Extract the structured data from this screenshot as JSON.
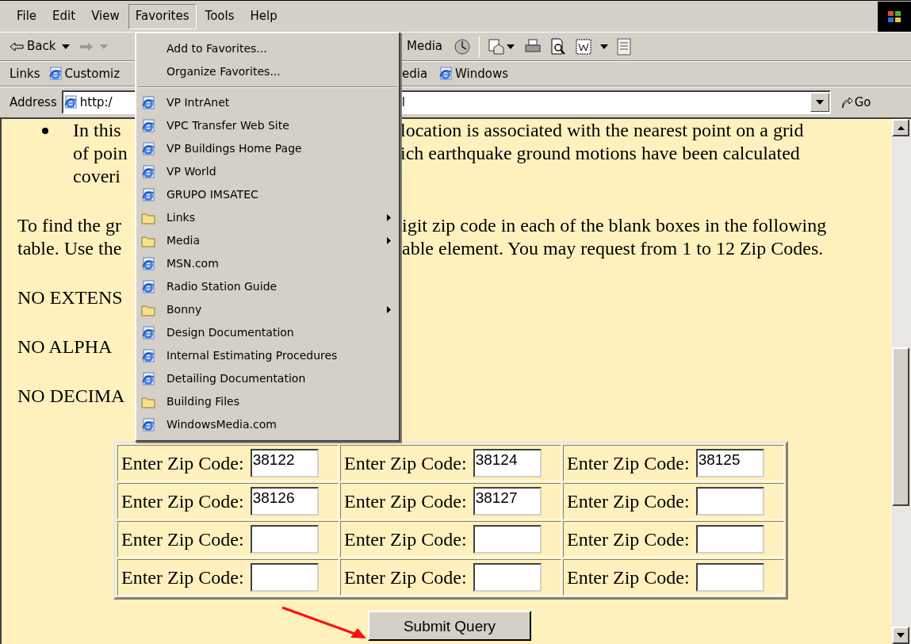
{
  "menubar": [
    {
      "label": "File",
      "selected": false
    },
    {
      "label": "Edit",
      "selected": false
    },
    {
      "label": "View",
      "selected": false
    },
    {
      "label": "Favorites",
      "selected": true
    },
    {
      "label": "Tools",
      "selected": false
    },
    {
      "label": "Help",
      "selected": false
    }
  ],
  "toolbar": {
    "back": "Back",
    "media": "Media"
  },
  "links_bar": {
    "label": "Links",
    "left_links": [
      "Customiz"
    ],
    "right_links": [
      {
        "label": "edia",
        "icon": false
      },
      {
        "label": "Windows",
        "icon": true
      }
    ]
  },
  "address_bar": {
    "label": "Address",
    "value_start": "http:/",
    "value_end": "l",
    "go": "Go"
  },
  "favorites_menu": [
    {
      "kind": "command",
      "label": "Add to Favorites..."
    },
    {
      "kind": "command",
      "label": "Organize Favorites..."
    },
    {
      "kind": "link",
      "label": "VP IntrAnet"
    },
    {
      "kind": "link",
      "label": "VPC Transfer Web Site"
    },
    {
      "kind": "link",
      "label": "VP Buildings Home Page"
    },
    {
      "kind": "link",
      "label": "VP World"
    },
    {
      "kind": "link",
      "label": "GRUPO IMSATEC"
    },
    {
      "kind": "folder",
      "label": "Links",
      "submenu": true
    },
    {
      "kind": "folder",
      "label": "Media",
      "submenu": true
    },
    {
      "kind": "link",
      "label": "MSN.com"
    },
    {
      "kind": "link",
      "label": "Radio Station Guide"
    },
    {
      "kind": "folder",
      "label": "Bonny",
      "submenu": true
    },
    {
      "kind": "link",
      "label": "Design Documentation"
    },
    {
      "kind": "link",
      "label": "Internal Estimating Procedures"
    },
    {
      "kind": "link",
      "label": "Detailing Documentation"
    },
    {
      "kind": "folder",
      "label": "Building Files",
      "submenu": false
    },
    {
      "kind": "link",
      "label": "WindowsMedia.com"
    }
  ],
  "page": {
    "paragraphs": [
      {
        "kind": "bullet",
        "lines": [
          {
            "left": "In this",
            "right": "location is associated with the nearest point on a grid"
          },
          {
            "left": "of poin",
            "right": "ich earthquake ground motions have been calculated"
          },
          {
            "left": "coveri"
          }
        ]
      },
      {
        "kind": "text",
        "lines": [
          {
            "left": "To find the gr",
            "right": "igit zip code in each of the blank boxes in the following"
          },
          {
            "left": "table. Use the",
            "right": "able element. You may request from 1 to 12 Zip Codes."
          }
        ]
      },
      {
        "kind": "text",
        "lines": [
          {
            "left": "NO EXTENS"
          }
        ]
      },
      {
        "kind": "text",
        "lines": [
          {
            "left": "NO ALPHA"
          }
        ]
      },
      {
        "kind": "text",
        "lines": [
          {
            "left": "NO DECIMA"
          }
        ]
      }
    ]
  },
  "zip_table": {
    "rows": [
      [
        {
          "label": "Enter Zip Code:",
          "value": "38122"
        },
        {
          "label": "Enter Zip Code:",
          "value": "38124"
        },
        {
          "label": "Enter Zip Code:",
          "value": "38125"
        }
      ],
      [
        {
          "label": "Enter Zip Code:",
          "value": "38126"
        },
        {
          "label": "Enter Zip Code:",
          "value": "38127"
        },
        {
          "label": "Enter Zip Code:"
        }
      ],
      [
        {
          "label": "Enter Zip Code:"
        },
        {
          "label": "Enter Zip Code:"
        },
        {
          "label": "Enter Zip Code:"
        }
      ],
      [
        {
          "label": "Enter Zip Code:"
        },
        {
          "label": "Enter Zip Code:"
        },
        {
          "label": "Enter Zip Code:"
        }
      ]
    ]
  },
  "submit": "Submit Query"
}
